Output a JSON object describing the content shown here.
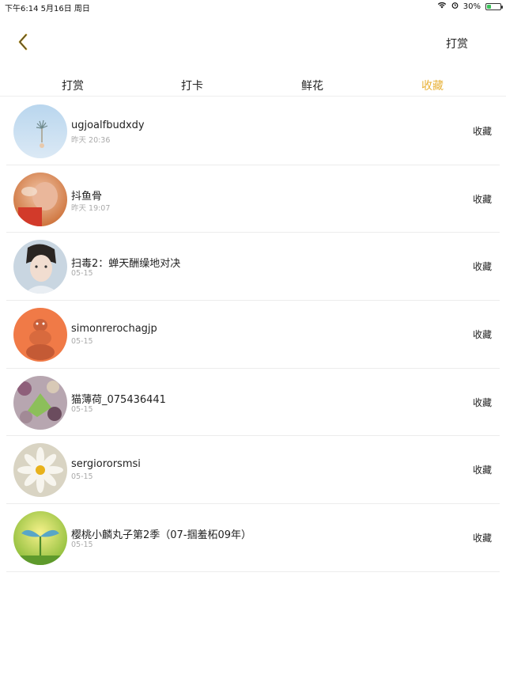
{
  "status": {
    "time_date": "下午6:14  5月16日 周日",
    "battery": "30%",
    "battery_level": 0.3,
    "battery_color": "#3cc35b"
  },
  "nav": {
    "back_icon": "chevron-left-icon",
    "action_label": "打赏"
  },
  "accent_color": "#e8b23a",
  "tabs": [
    {
      "label": "打赏"
    },
    {
      "label": "打卡"
    },
    {
      "label": "鲜花"
    },
    {
      "label": "收藏",
      "active": true
    }
  ],
  "items": [
    {
      "name": "ugjoalfbudxdy",
      "time": "昨天 20:36",
      "action": "收藏"
    },
    {
      "name": "抖鱼骨",
      "time": "昨天 19:07",
      "action": "收藏"
    },
    {
      "name": "扫毒2：蝉天酬缲地对决",
      "time": "05-15",
      "action": "收藏"
    },
    {
      "name": "simonrerochagjp",
      "time": "05-15",
      "action": "收藏"
    },
    {
      "name": "猫薄荷_075436441",
      "time": "05-15",
      "action": "收藏"
    },
    {
      "name": "sergiororsmsi",
      "time": "05-15",
      "action": "收藏"
    },
    {
      "name": "樱桃小麟丸子第2季（07-掴羞柘09年）",
      "time": "05-15",
      "action": "收藏"
    }
  ]
}
